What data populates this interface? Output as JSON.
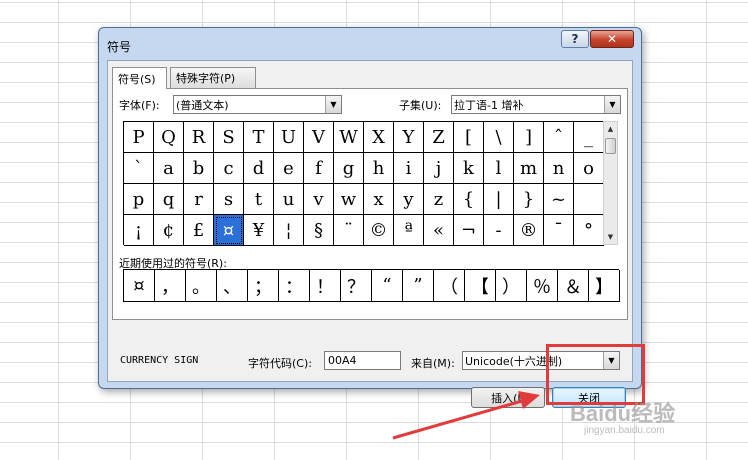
{
  "dialog": {
    "title": "符号",
    "help_label": "?",
    "close_glyph": "✕"
  },
  "tabs": [
    {
      "label": "符号(S)",
      "active": true
    },
    {
      "label": "特殊字符(P)",
      "active": false
    }
  ],
  "font": {
    "label": "字体(F):",
    "value": "(普通文本)"
  },
  "subset": {
    "label": "子集(U):",
    "value": "拉丁语-1 增补"
  },
  "symbols": [
    [
      "P",
      "Q",
      "R",
      "S",
      "T",
      "U",
      "V",
      "W",
      "X",
      "Y",
      "Z",
      "[",
      "\\",
      "]",
      "ˆ",
      "_"
    ],
    [
      "`",
      "a",
      "b",
      "c",
      "d",
      "e",
      "f",
      "g",
      "h",
      "i",
      "j",
      "k",
      "l",
      "m",
      "n",
      "o"
    ],
    [
      "p",
      "q",
      "r",
      "s",
      "t",
      "u",
      "v",
      "w",
      "x",
      "y",
      "z",
      "{",
      "|",
      "}",
      "~",
      ""
    ],
    [
      "¡",
      "¢",
      "£",
      "¤",
      "¥",
      "¦",
      "§",
      "¨",
      "©",
      "ª",
      "«",
      "¬",
      "-",
      "®",
      "¯",
      "°"
    ]
  ],
  "selected_symbol": "¤",
  "recent": {
    "label": "近期使用过的符号(R):",
    "symbols": [
      "¤",
      "，",
      "。",
      "、",
      "；",
      "：",
      "！",
      "？",
      "“",
      "”",
      "（",
      "【",
      "）",
      "％",
      "＆",
      "】"
    ]
  },
  "char_name": "CURRENCY SIGN",
  "char_code": {
    "label": "字符代码(C):",
    "value": "00A4"
  },
  "from": {
    "label": "来自(M):",
    "value": "Unicode(十六进制)"
  },
  "buttons": {
    "insert": "插入(I)",
    "close": "关闭"
  },
  "watermark": {
    "main": "Baidu经验",
    "sub": "jingyan.baidu.com"
  },
  "colors": {
    "selection": "#2a70d8",
    "annotation": "#e23b3b",
    "dialog_frame": "#c5d8ef"
  }
}
